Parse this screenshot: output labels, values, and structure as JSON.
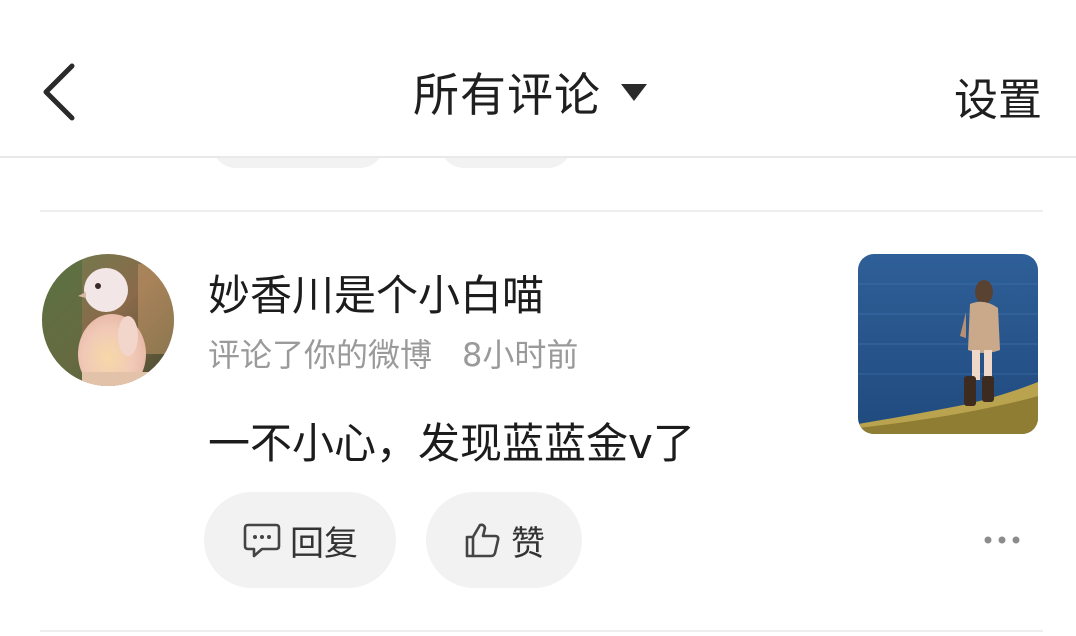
{
  "nav": {
    "back_icon": "chevron-left-icon",
    "title": "所有评论",
    "caret_icon": "caret-down-icon",
    "settings_label": "设置"
  },
  "notification": {
    "username": "妙香川是个小白喵",
    "action_text": "评论了你的微博",
    "time": "8小时前",
    "comment": "一不小心，发现蓝蓝金v了",
    "reply_label": "回复",
    "reply_icon": "comment-icon",
    "like_label": "赞",
    "like_icon": "thumbs-up-icon",
    "more_icon": "more-horizontal-icon"
  },
  "colors": {
    "background": "#ffffff",
    "text_primary": "#1c1c1c",
    "text_secondary": "#9a9a9a",
    "button_bg": "#f2f2f2",
    "divider": "#eeeeee"
  }
}
